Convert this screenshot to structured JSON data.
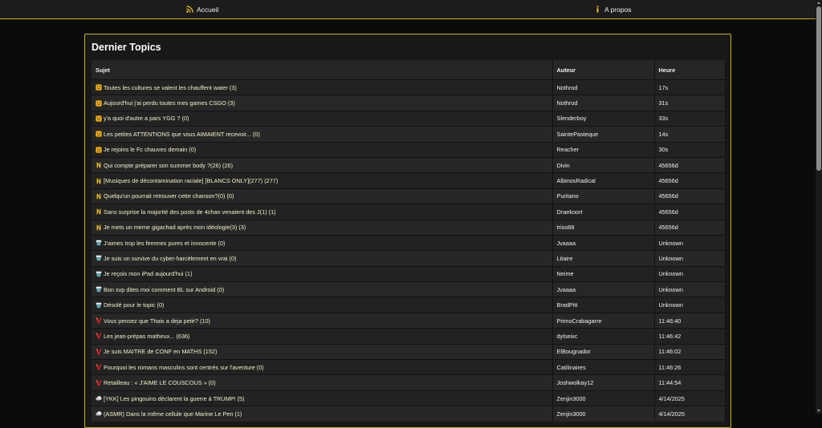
{
  "nav": {
    "home_label": "Accueil",
    "about_label": "A propos"
  },
  "panel": {
    "title": "Dernier Topics"
  },
  "table": {
    "headers": {
      "subject": "Sujet",
      "author": "Auteur",
      "time": "Heure"
    },
    "rows": [
      {
        "icon": "smiley-icon",
        "subject": "Toutes les cultures se valent les chauffent water (3)",
        "author": "Nothrod",
        "time": "17s"
      },
      {
        "icon": "smiley-icon",
        "subject": "Aujourd'hui j'ai perdu toutes mes games CSGO (3)",
        "author": "Nothrod",
        "time": "31s"
      },
      {
        "icon": "smiley-icon",
        "subject": "y'a quoi d'autre a pars YGG ? (0)",
        "author": "Slenderboy",
        "time": "33s"
      },
      {
        "icon": "smiley-icon",
        "subject": "Les petites ATTENTIONS que vous AIMAIENT recevoir... (0)",
        "author": "SaintePasteque",
        "time": "14s"
      },
      {
        "icon": "smiley-icon",
        "subject": "Je rejoins le Fc chauves demain (0)",
        "author": "Reacher",
        "time": "30s"
      },
      {
        "icon": "n-logo-icon",
        "subject": "Qui compte préparer son summer body ?(26) (26)",
        "author": "Divin",
        "time": "45656d"
      },
      {
        "icon": "n-logo-icon",
        "subject": "[Musiques de décontamination raciale] [BLANCS ONLY](277) (277)",
        "author": "AlbinosRadical",
        "time": "45656d"
      },
      {
        "icon": "n-logo-icon",
        "subject": "Quelqu'un pourrait retrouver cette chanson?(0) (0)",
        "author": "Puritano",
        "time": "45656d"
      },
      {
        "icon": "n-logo-icon",
        "subject": "Sans surprise la majorité des posts de 4chan venaient des J(1) (1)",
        "author": "Draekoort",
        "time": "45656d"
      },
      {
        "icon": "n-logo-icon",
        "subject": "Je mets un meme gigachad après mon idéologie(3) (3)",
        "author": "triso88",
        "time": "45656d"
      },
      {
        "icon": "cup-icon",
        "subject": "J'aimes trop les femmes pures et innocente (0)",
        "author": "Jvaaaa",
        "time": "Unknown"
      },
      {
        "icon": "cup-icon",
        "subject": "Je suis un survive du cyber-harcèlement en vrai (0)",
        "author": "Litaire",
        "time": "Unknown"
      },
      {
        "icon": "cup-icon",
        "subject": "Je reçois mon iPad aujourd'hui (1)",
        "author": "Neime",
        "time": "Unknown"
      },
      {
        "icon": "cup-icon",
        "subject": "Bon svp dites moi comment BL sur Android (0)",
        "author": "Jvaaaa",
        "time": "Unknown"
      },
      {
        "icon": "cup-icon",
        "subject": "Désolé pour le topic (0)",
        "author": "BradPitt",
        "time": "Unknown"
      },
      {
        "icon": "v-logo-icon",
        "subject": "Vous pensez que Thais a deja peté? (10)",
        "author": "PrimoCrabagarre",
        "time": "11:46:40"
      },
      {
        "icon": "v-logo-icon",
        "subject": "Les jean-prépas matheux... (636)",
        "author": "dylseixc",
        "time": "11:46:42"
      },
      {
        "icon": "v-logo-icon",
        "subject": "Je suis MAITRE de CONF en MATHS (152)",
        "author": "ElBougnador",
        "time": "11:46:02"
      },
      {
        "icon": "v-logo-icon",
        "subject": "Pourquoi les romans masculins sont centrés sur l'aventure (0)",
        "author": "Catilinaires",
        "time": "11:46:26"
      },
      {
        "icon": "v-logo-icon",
        "subject": "Retailleau : « J'AIME LE COUSCOUS » (0)",
        "author": "Joshwolkay12",
        "time": "11:44:54"
      },
      {
        "icon": "cloud-icon",
        "subject": "[YKK] Les pingouins déclarent la guerre à TRUMP! (5)",
        "author": "Zenjin3000",
        "time": "4/14/2025"
      },
      {
        "icon": "cloud-icon",
        "subject": "(ASMR) Dans la même cellule que Marine Le Pen (1)",
        "author": "Zenjin3000",
        "time": "4/14/2025"
      }
    ]
  }
}
